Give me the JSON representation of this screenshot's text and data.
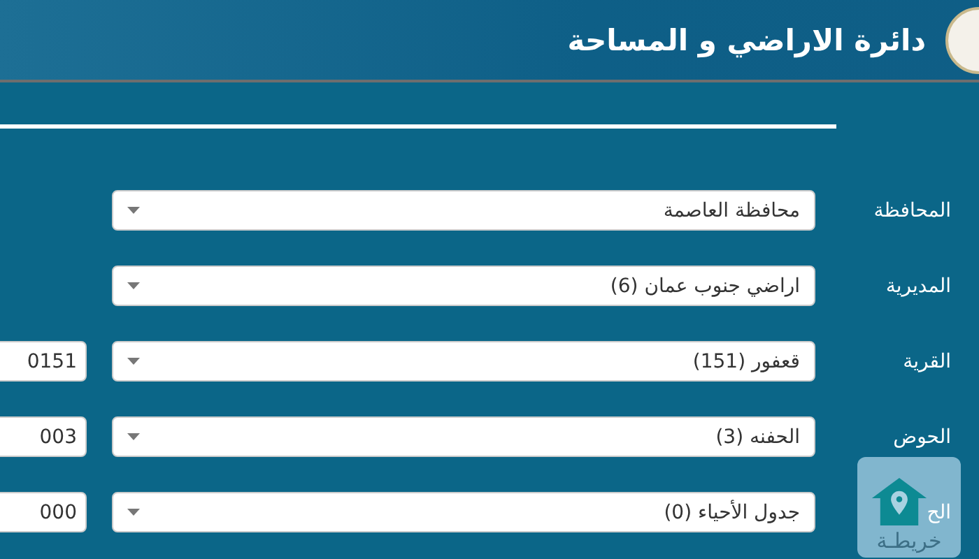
{
  "header": {
    "title": "دائرة الاراضي و المساحة"
  },
  "rows": [
    {
      "label": "المحافظة",
      "value": "محافظة العاصمة"
    },
    {
      "label": "المديرية",
      "value": "اراضي جنوب عمان (6)"
    },
    {
      "label": "القرية",
      "value": "قعفور (151)",
      "code": "0151"
    },
    {
      "label": "الحوض",
      "value": "الحفنه (3)",
      "code": "003"
    },
    {
      "label": "الح",
      "value": "جدول الأحياء (0)",
      "code": "000"
    }
  ],
  "map_button": {
    "label": "خريطـة"
  }
}
